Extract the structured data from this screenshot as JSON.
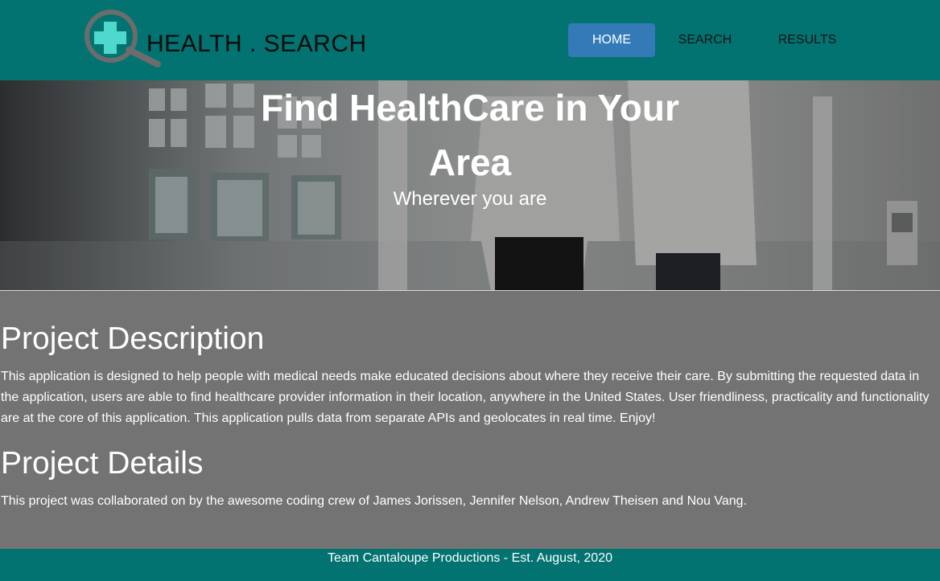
{
  "brand": {
    "name": "HEALTH . SEARCH"
  },
  "nav": [
    {
      "label": "HOME",
      "active": true
    },
    {
      "label": "SEARCH",
      "active": false
    },
    {
      "label": "RESULTS",
      "active": false
    }
  ],
  "hero": {
    "title": "Find HealthCare in Your Area",
    "subtitle": "Wherever you are"
  },
  "description": {
    "heading": "Project Description",
    "text": "This application is designed to help people with medical needs make educated decisions about where they receive their care. By submitting the requested data in the application, users are able to find healthcare provider information in their location, anywhere in the United States. User friendliness, practicality and functionality are at the core of this application. This application pulls data from separate APIs and geolocates in real time. Enjoy!"
  },
  "details": {
    "heading": "Project Details",
    "text": "This project was collaborated on by the awesome coding crew of James Jorissen, Jennifer Nelson, Andrew Theisen and Nou Vang."
  },
  "footer": {
    "text": "Team Cantaloupe Productions - Est. August, 2020"
  },
  "colors": {
    "header_bg": "#027371",
    "nav_active": "#337ab7",
    "page_bg": "#737373",
    "logo_cross": "#4fd8cc",
    "logo_lens": "#6c6c6c"
  },
  "icons": {
    "logo": "magnifier-medical-cross-icon"
  }
}
